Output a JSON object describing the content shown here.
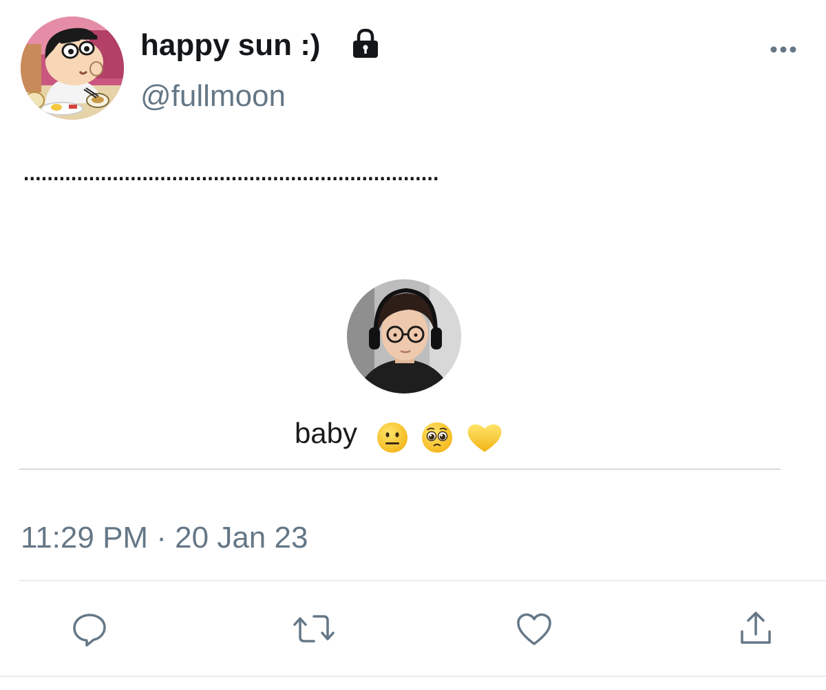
{
  "tweet": {
    "display_name": "happy sun :)",
    "handle": "@fullmoon",
    "text": "......................................................................",
    "timestamp": "11:29 PM · 20 Jan 23"
  },
  "media": {
    "caption": "baby",
    "emojis": [
      "neutral-face",
      "pleading-face",
      "yellow-heart"
    ]
  },
  "icons": {
    "lock": "lock-icon",
    "more": "more-icon",
    "reply": "reply-icon",
    "retweet": "retweet-icon",
    "like": "heart-icon",
    "share": "share-icon"
  },
  "colors": {
    "primary_text": "#14171a",
    "secondary_text": "#657786",
    "divider": "#e6ecf0"
  }
}
